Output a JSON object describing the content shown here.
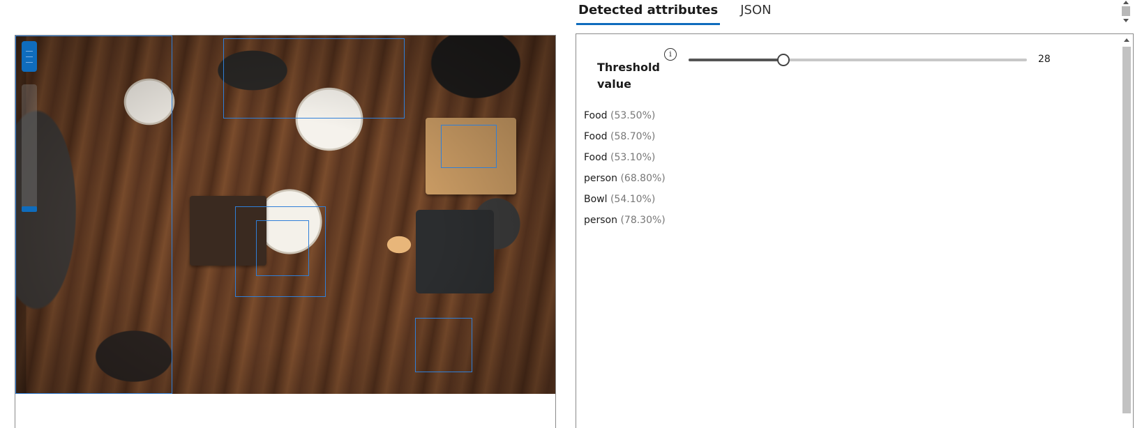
{
  "tabs": [
    {
      "label": "Detected attributes",
      "active": true
    },
    {
      "label": "JSON",
      "active": false
    }
  ],
  "threshold": {
    "label": "Threshold value",
    "value": "28",
    "fraction": 0.28,
    "info_icon": "info-icon"
  },
  "attributes": [
    {
      "name": "Food",
      "confidence": "(53.50%)"
    },
    {
      "name": "Food",
      "confidence": "(58.70%)"
    },
    {
      "name": "Food",
      "confidence": "(53.10%)"
    },
    {
      "name": "person",
      "confidence": "(68.80%)"
    },
    {
      "name": "Bowl",
      "confidence": "(54.10%)"
    },
    {
      "name": "person",
      "confidence": "(78.30%)"
    }
  ],
  "colors": {
    "accent": "#0f6cbd",
    "bbox": "#2f7fd8"
  }
}
